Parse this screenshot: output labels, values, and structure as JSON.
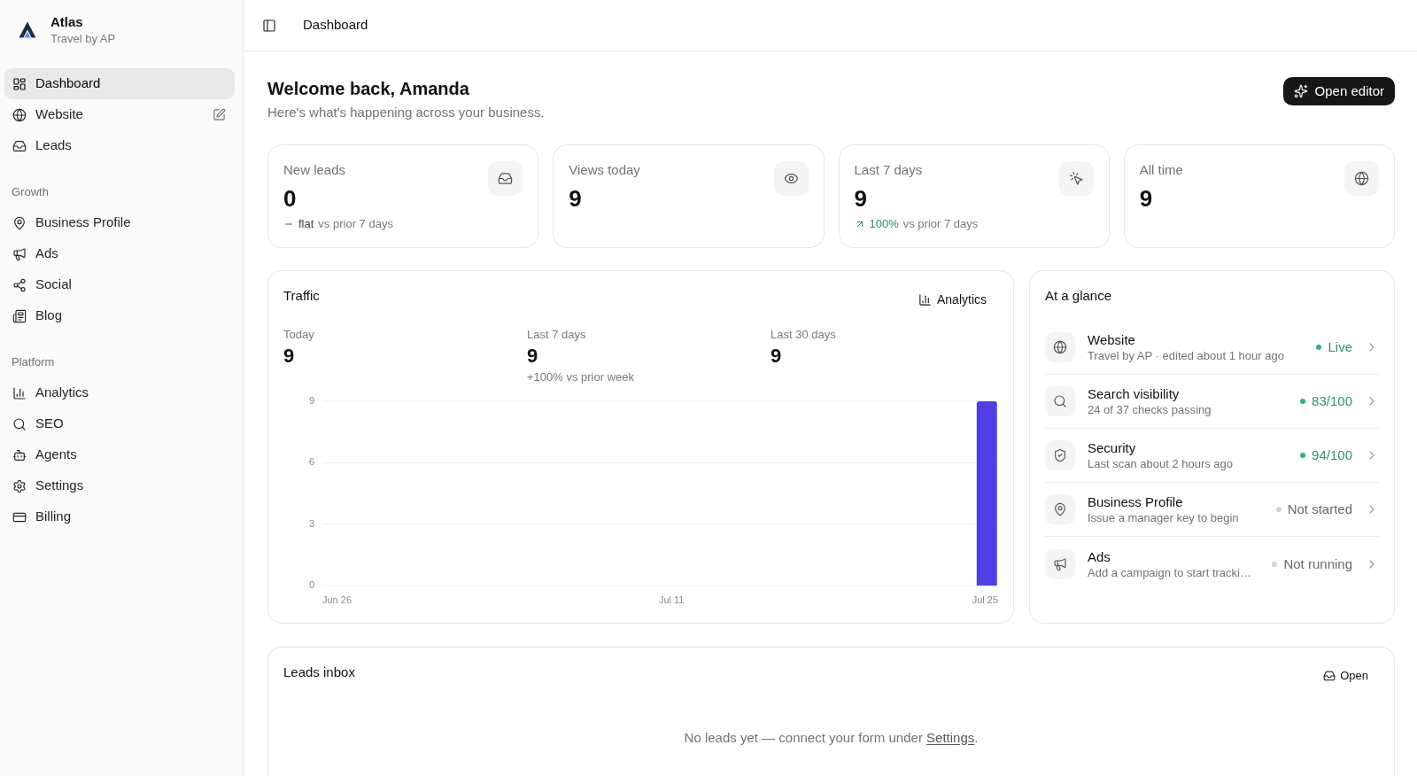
{
  "sidebar": {
    "brand": {
      "name": "Atlas",
      "subtitle": "Travel by AP"
    },
    "groups": [
      {
        "items": [
          {
            "label": "Dashboard",
            "selected": true,
            "kind": "link"
          },
          {
            "label": "Website",
            "selected": false,
            "kind": "editable"
          },
          {
            "label": "Leads",
            "selected": false,
            "kind": "link"
          }
        ]
      },
      {
        "heading": "Growth",
        "items": [
          {
            "label": "Business Profile",
            "selected": false,
            "kind": "link"
          },
          {
            "label": "Ads",
            "selected": false,
            "kind": "link"
          },
          {
            "label": "Social",
            "selected": false,
            "kind": "link"
          },
          {
            "label": "Blog",
            "selected": false,
            "kind": "link"
          }
        ]
      },
      {
        "heading": "Platform",
        "items": [
          {
            "label": "Analytics",
            "selected": false,
            "kind": "link"
          },
          {
            "label": "SEO",
            "selected": false,
            "kind": "link"
          },
          {
            "label": "Agents",
            "selected": false,
            "kind": "link"
          },
          {
            "label": "Settings",
            "selected": false,
            "kind": "link"
          },
          {
            "label": "Billing",
            "selected": false,
            "kind": "link"
          }
        ]
      }
    ]
  },
  "header": {
    "title": "Dashboard"
  },
  "welcome": {
    "title": "Welcome back, Amanda",
    "subtitle": "Here's what's happening across your business.",
    "button": "Open editor"
  },
  "stats": [
    {
      "label": "New leads",
      "value": "0",
      "kind": "flat",
      "change": "flat",
      "comparison": "vs prior 7 days"
    },
    {
      "label": "Views today",
      "value": "9"
    },
    {
      "label": "Last 7 days",
      "value": "9",
      "kind": "up",
      "change": "100%",
      "comparison": "vs prior 7 days"
    },
    {
      "label": "All time",
      "value": "9"
    }
  ],
  "traffic": {
    "title": "Traffic",
    "button": "Analytics",
    "metrics": [
      {
        "label": "Today",
        "value": "9"
      },
      {
        "label": "Last 7 days",
        "value": "9",
        "note": "+100% vs prior week"
      },
      {
        "label": "Last 30 days",
        "value": "9"
      }
    ],
    "chart_data": {
      "type": "bar",
      "categories": [
        "Jun 26",
        null,
        null,
        null,
        null,
        null,
        null,
        null,
        null,
        null,
        null,
        null,
        null,
        null,
        null,
        "Jul 11",
        null,
        null,
        null,
        null,
        null,
        null,
        null,
        null,
        null,
        null,
        null,
        null,
        null,
        "Jul 25"
      ],
      "values": [
        0,
        0,
        0,
        0,
        0,
        0,
        0,
        0,
        0,
        0,
        0,
        0,
        0,
        0,
        0,
        0,
        0,
        0,
        0,
        0,
        0,
        0,
        0,
        0,
        0,
        0,
        0,
        0,
        0,
        9
      ],
      "ylim": [
        0,
        9
      ],
      "yticks": [
        {
          "value": 0,
          "label": "0"
        },
        {
          "value": 3,
          "label": "3"
        },
        {
          "value": 6,
          "label": "6"
        },
        {
          "value": 9,
          "label": "9"
        }
      ]
    }
  },
  "glance": {
    "title": "At a glance",
    "rows": [
      {
        "title": "Website",
        "subtitle": "Travel by AP · edited about 1 hour ago",
        "status": "Live",
        "kind": "good",
        "color": "#34b073"
      },
      {
        "title": "Search visibility",
        "subtitle": "24 of 37 checks passing",
        "status": "83/100",
        "kind": "good",
        "color": "#34b073"
      },
      {
        "title": "Security",
        "subtitle": "Last scan about 2 hours ago",
        "status": "94/100",
        "kind": "good",
        "color": "#34b073"
      },
      {
        "title": "Business Profile",
        "subtitle": "Issue a manager key to begin",
        "status": "Not started",
        "kind": "idle",
        "color": "#d4d4d4"
      },
      {
        "title": "Ads",
        "subtitle": "Add a campaign to start tracki…",
        "status": "Not running",
        "kind": "idle",
        "color": "#d4d4d4"
      }
    ]
  },
  "leads_inbox": {
    "title": "Leads inbox",
    "button": "Open",
    "message": "No leads yet — connect your form under",
    "link": "Settings",
    "end": "."
  }
}
